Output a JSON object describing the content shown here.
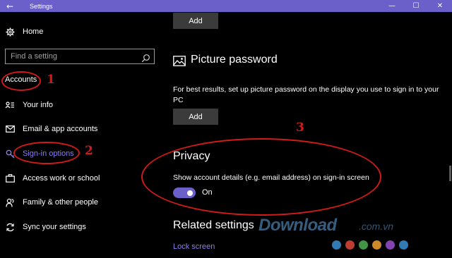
{
  "window": {
    "title": "Settings",
    "back_glyph": "←",
    "minimize_glyph": "—",
    "maximize_glyph": "☐",
    "close_glyph": "✕",
    "accent": "#6b5fc9"
  },
  "sidebar": {
    "home_label": "Home",
    "search_placeholder": "Find a setting",
    "section_label": "Accounts",
    "items": [
      {
        "label": "Your info",
        "icon": "person-card-icon"
      },
      {
        "label": "Email & app accounts",
        "icon": "envelope-icon"
      },
      {
        "label": "Sign-in options",
        "icon": "key-icon",
        "active": true
      },
      {
        "label": "Access work or school",
        "icon": "briefcase-icon"
      },
      {
        "label": "Family & other people",
        "icon": "people-icon"
      },
      {
        "label": "Sync your settings",
        "icon": "sync-icon"
      }
    ]
  },
  "content": {
    "top_add_label": "Add",
    "picture_password": {
      "heading": "Picture password",
      "description": "For best results, set up picture password on the display you use to sign in to your PC",
      "add_label": "Add"
    },
    "privacy": {
      "heading": "Privacy",
      "description": "Show account details (e.g. email address) on sign-in screen",
      "toggle_state": "On",
      "toggle_on": true
    },
    "related": {
      "heading": "Related settings",
      "link": "Lock screen"
    }
  },
  "annotations": {
    "n1": "1",
    "n2": "2",
    "n3": "3",
    "color": "#d11a1a"
  },
  "watermark": {
    "brand": "Download",
    "suffix": ".com.vn",
    "dot_colors": [
      "#3b8fd4",
      "#e0463a",
      "#4caf50",
      "#f0a030",
      "#9c4fd0",
      "#3b8fd4"
    ]
  }
}
